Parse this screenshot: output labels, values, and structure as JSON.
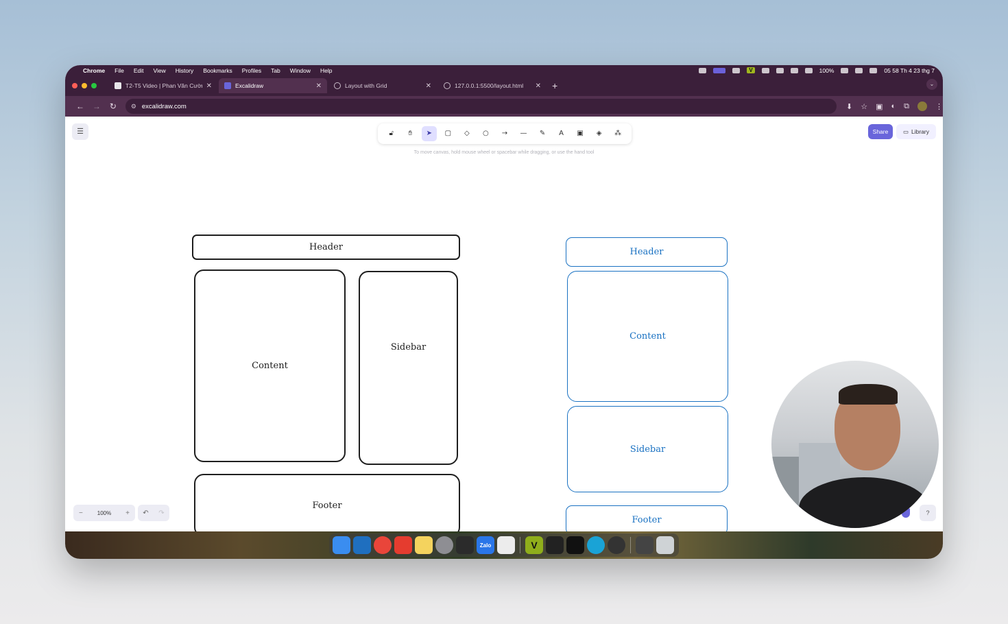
{
  "menubar": {
    "app": "Chrome",
    "items": [
      "File",
      "Edit",
      "View",
      "History",
      "Bookmarks",
      "Profiles",
      "Tab",
      "Window",
      "Help"
    ],
    "battery": "100%",
    "clock": "05 58 Th 4 23 thg 7",
    "v_badge": "V"
  },
  "tabs": [
    {
      "label": "T2-T5 Video | Phan Văn Cườn",
      "icon": "notion-icon"
    },
    {
      "label": "Excalidraw",
      "icon": "excalidraw-icon"
    },
    {
      "label": "Layout with Grid",
      "icon": "globe-icon"
    },
    {
      "label": "127.0.0.1:5500/layout.html",
      "icon": "globe-icon"
    }
  ],
  "address": {
    "url": "excalidraw.com"
  },
  "toolbar": {
    "hint": "To move canvas, hold mouse wheel or spacebar while dragging, or use the hand tool",
    "share": "Share",
    "library": "Library"
  },
  "left_layout": {
    "header": "Header",
    "content": "Content",
    "sidebar": "Sidebar",
    "footer": "Footer"
  },
  "right_layout": {
    "header": "Header",
    "content": "Content",
    "sidebar": "Sidebar",
    "footer": "Footer"
  },
  "zoom": {
    "value": "100%",
    "minus": "−",
    "plus": "+"
  },
  "dock": {
    "zalo": "Zalo",
    "vim": "V"
  },
  "colors": {
    "chrome_frame": "#3b1f3a",
    "accent": "#6965db",
    "stroke_black": "#1e1e1e",
    "stroke_blue": "#1971c2"
  }
}
